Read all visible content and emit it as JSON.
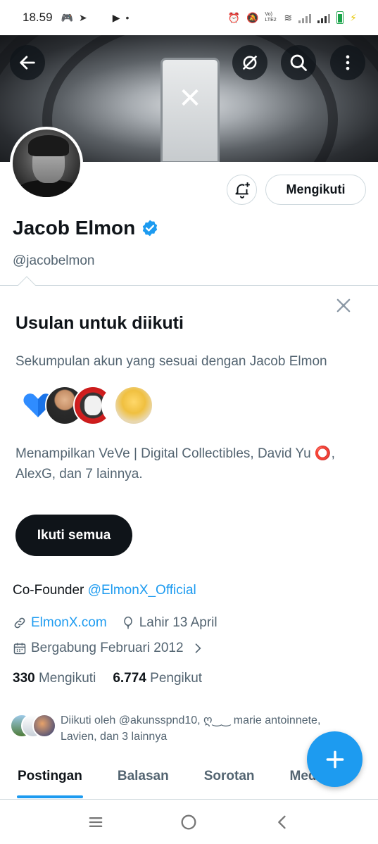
{
  "status_bar": {
    "time": "18.59",
    "network_label": "Vo) LTE2"
  },
  "profile": {
    "name": "Jacob Elmon",
    "handle": "@jacobelmon",
    "follow_button": "Mengikuti",
    "bio_prefix": "Co-Founder ",
    "bio_mention": "@ElmonX_Official",
    "website": "ElmonX.com",
    "birthday": "Lahir 13 April",
    "joined": "Bergabung Februari 2012",
    "following_count": "330",
    "following_label": "Mengikuti",
    "followers_count": "6.774",
    "followers_label": "Pengikut",
    "followed_by_line1": "Diikuti oleh @akunsspnd10, ღ‿‿ marie antoinnete,",
    "followed_by_line2": "Lavien, dan 3 lainnya"
  },
  "suggestions": {
    "title": "Usulan untuk diikuti",
    "description": "Sekumpulan akun yang sesuai dengan Jacob Elmon",
    "list_text": "Menampilkan VeVe | Digital Collectibles, David Yu ⭕, AlexG, dan 7 lainnya.",
    "follow_all": "Ikuti semua"
  },
  "tabs": [
    "Postingan",
    "Balasan",
    "Sorotan",
    "Media"
  ],
  "colors": {
    "accent": "#1d9bf0",
    "text": "#0f1419",
    "muted": "#536471"
  }
}
